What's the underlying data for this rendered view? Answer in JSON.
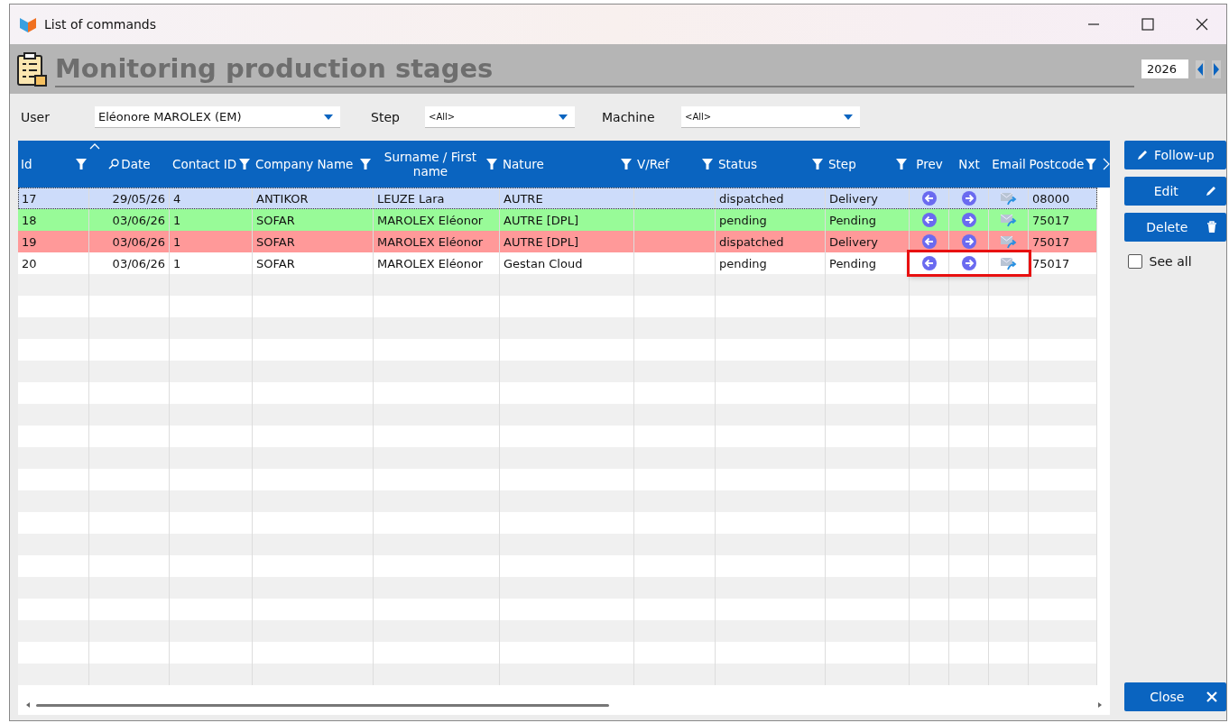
{
  "window": {
    "title": "List of commands"
  },
  "header": {
    "title": "Monitoring production stages",
    "year": "2026"
  },
  "filters": [
    {
      "label": "User",
      "value": "Eléonore MAROLEX (EM)"
    },
    {
      "label": "Step",
      "value": "<All>"
    },
    {
      "label": "Machine",
      "value": "<All>"
    }
  ],
  "table": {
    "columns": [
      {
        "label": "Id",
        "filter": true,
        "search": false,
        "sorted": false
      },
      {
        "label": "Date",
        "filter": false,
        "search": true,
        "sorted": true
      },
      {
        "label": "Contact ID",
        "filter": true,
        "search": false,
        "sorted": false
      },
      {
        "label": "Company Name",
        "filter": true,
        "search": false,
        "sorted": false
      },
      {
        "label": "Surname / First name",
        "filter": true,
        "search": false,
        "sorted": false
      },
      {
        "label": "Nature",
        "filter": true,
        "search": false,
        "sorted": false
      },
      {
        "label": "V/Ref",
        "filter": true,
        "search": false,
        "sorted": false
      },
      {
        "label": "Status",
        "filter": true,
        "search": false,
        "sorted": false
      },
      {
        "label": "Step",
        "filter": true,
        "search": false,
        "sorted": false
      },
      {
        "label": "Prev",
        "filter": false,
        "search": false,
        "sorted": false
      },
      {
        "label": "Nxt",
        "filter": false,
        "search": false,
        "sorted": false
      },
      {
        "label": "Email",
        "filter": false,
        "search": false,
        "sorted": false
      },
      {
        "label": "Postcode",
        "filter": true,
        "search": false,
        "sorted": false
      }
    ],
    "rows": [
      {
        "id": "17",
        "date": "29/05/26",
        "contact_id": "4",
        "company": "ANTIKOR",
        "name": "LEUZE Lara",
        "nature": "AUTRE",
        "status": "dispatched",
        "step": "Delivery",
        "postcode": "08000",
        "color": "#cddcfa",
        "selected": true,
        "highlighted": false
      },
      {
        "id": "18",
        "date": "03/06/26",
        "contact_id": "1",
        "company": "SOFAR",
        "name": "MAROLEX Eléonor",
        "nature": "AUTRE [DPL]",
        "status": "pending",
        "step": "Pending",
        "postcode": "75017",
        "color": "#98fb98",
        "selected": false,
        "highlighted": false
      },
      {
        "id": "19",
        "date": "03/06/26",
        "contact_id": "1",
        "company": "SOFAR",
        "name": "MAROLEX Eléonor",
        "nature": "AUTRE [DPL]",
        "status": "dispatched",
        "step": "Delivery",
        "postcode": "75017",
        "color": "#ff9999",
        "selected": false,
        "highlighted": false
      },
      {
        "id": "20",
        "date": "03/06/26",
        "contact_id": "1",
        "company": "SOFAR",
        "name": "MAROLEX Eléonor",
        "nature": "Gestan Cloud",
        "status": "pending",
        "step": "Pending",
        "postcode": "75017",
        "color": "#ffffff",
        "selected": false,
        "highlighted": true
      }
    ]
  },
  "actions": [
    {
      "label": "Follow-up",
      "kind": "pencil-left"
    },
    {
      "label": "Edit",
      "kind": "pencil-right"
    },
    {
      "label": "Delete",
      "kind": "trash"
    }
  ],
  "see_all": {
    "label": "See all",
    "checked": false
  },
  "close_button": {
    "label": "Close"
  }
}
